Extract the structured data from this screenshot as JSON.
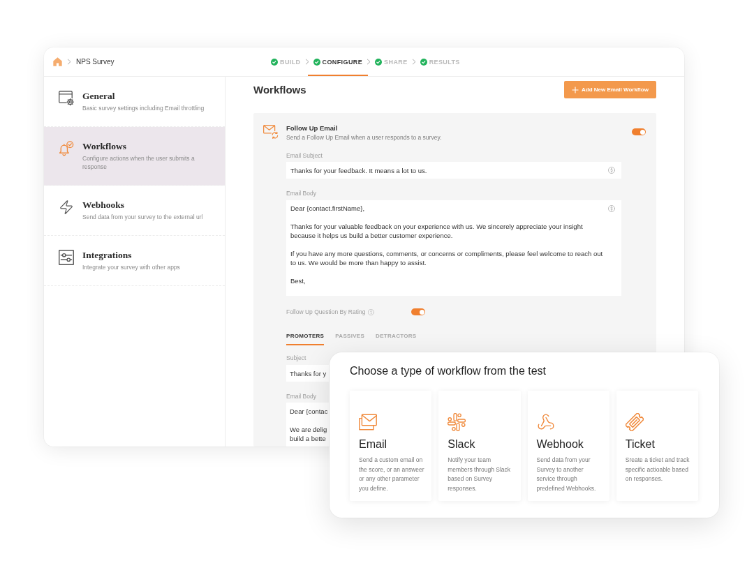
{
  "header": {
    "breadcrumb": "NPS Survey",
    "steps": [
      {
        "label": "BUILD",
        "completed": true,
        "selected": false
      },
      {
        "label": "CONFIGURE",
        "completed": true,
        "selected": true
      },
      {
        "label": "SHARE",
        "completed": true,
        "selected": false
      },
      {
        "label": "RESULTS",
        "completed": true,
        "selected": false
      }
    ]
  },
  "sidebar": {
    "items": [
      {
        "title": "General",
        "description": "Basic survey settings including Email throttling",
        "selected": false
      },
      {
        "title": "Workflows",
        "description": "Configure actions when the user submits a response",
        "selected": true
      },
      {
        "title": "Webhooks",
        "description": "Send data from your survey to the external url",
        "selected": false
      },
      {
        "title": "Integrations",
        "description": "Integrate your survey with other apps",
        "selected": false
      }
    ]
  },
  "content": {
    "title": "Workflows",
    "add_button": "Add New Email Workflow",
    "workflow": {
      "title": "Follow Up Email",
      "description": "Send a Follow Up Email when a user responds to a survey.",
      "on": true,
      "fields": [
        {
          "kind": "input",
          "label": "Email Subject",
          "value": "Thanks for your feedback. It means a lot to us."
        },
        {
          "kind": "textarea",
          "label": "Email Body",
          "value": "Dear {contact.firstName},\n\nThanks for your valuable feedback on your experience with us. We sincerely appreciate your insight because it helps us build a better customer experience.\n\nIf you have any more questions, comments, or concerns or compliments, please feel welcome to reach out to us. We would be more than happy to assist.\n\nBest,"
        }
      ],
      "rating": {
        "label": "Follow Up Question By Rating",
        "on": true
      },
      "tabs": [
        {
          "label": "PROMOTERS",
          "selected": true
        },
        {
          "label": "PASSIVES",
          "selected": false
        },
        {
          "label": "DETRACTORS",
          "selected": false
        }
      ],
      "tab_fields": [
        {
          "kind": "input",
          "label": "Subject",
          "value": "Thanks for y"
        },
        {
          "kind": "textarea",
          "label": "Email Body",
          "value": "Dear {contac\n\nWe are delig\nbuild a bette"
        }
      ]
    }
  },
  "overlay": {
    "title": "Choose a type of workflow from the test",
    "types": [
      {
        "title": "Email",
        "description": "Send a custom email on the score, or an answeer or any other parameter you define."
      },
      {
        "title": "Slack",
        "description": "Notify your team members through Slack based on Survey responses."
      },
      {
        "title": "Webhook",
        "description": "Send data from your Survey to another service through predefined Webhooks."
      },
      {
        "title": "Ticket",
        "description": "Sreate a ticket and track specific actioable based on responses."
      }
    ]
  }
}
